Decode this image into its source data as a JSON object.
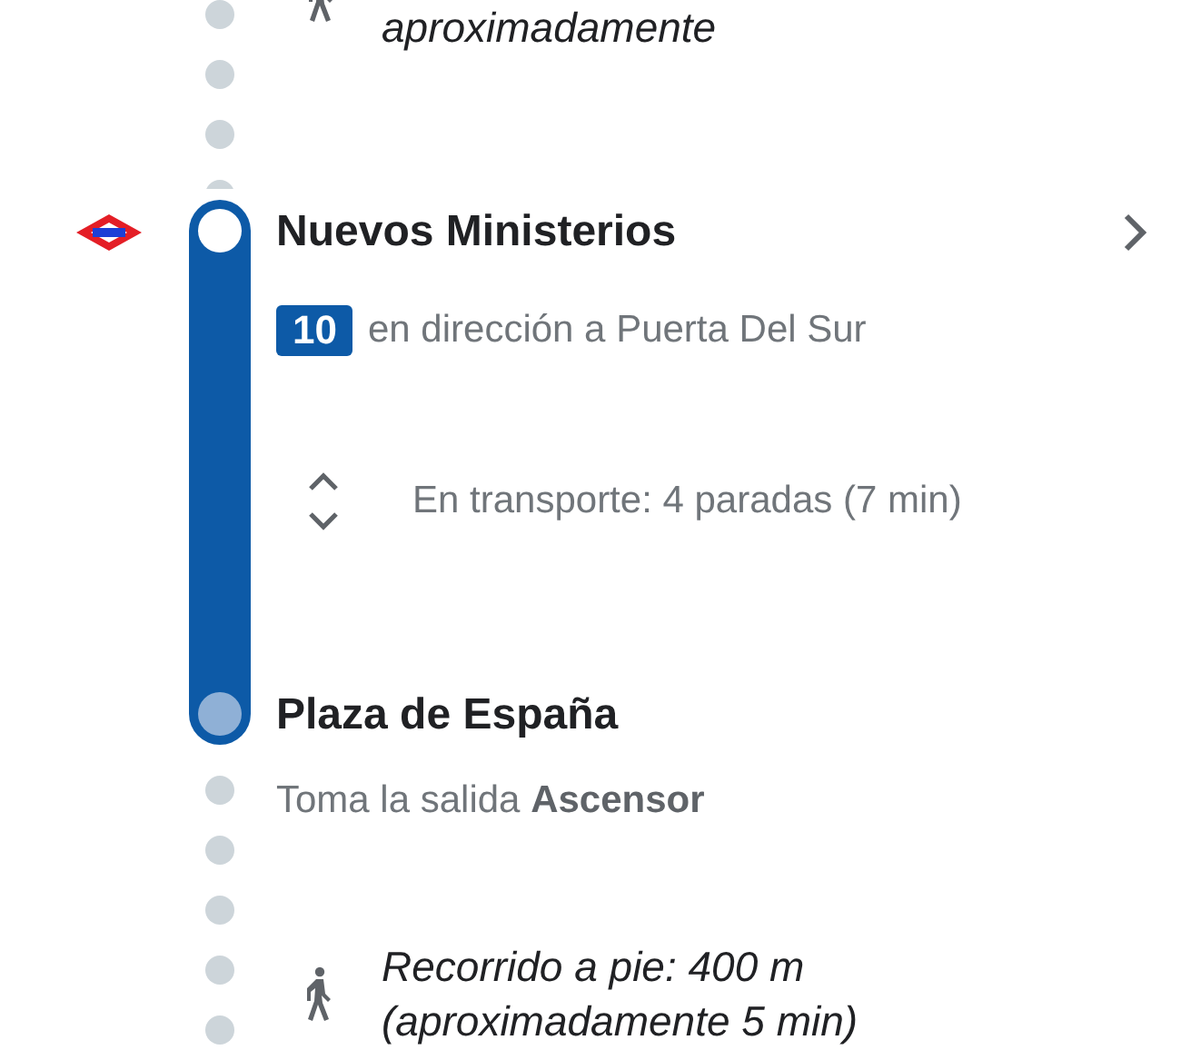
{
  "previous_walk": {
    "text": "aproximadamente"
  },
  "transit": {
    "departure_stop": "Nuevos Ministerios",
    "line": "10",
    "direction": "en dirección a Puerta Del Sur",
    "ride_summary": "En transporte: 4 paradas (7 min)",
    "arrival_stop": "Plaza de España"
  },
  "exit_instruction": "Toma la salida **Ascensor**",
  "walk": {
    "text": "Recorrido a pie: 400 m\n(aproximadamente 5 min)"
  }
}
